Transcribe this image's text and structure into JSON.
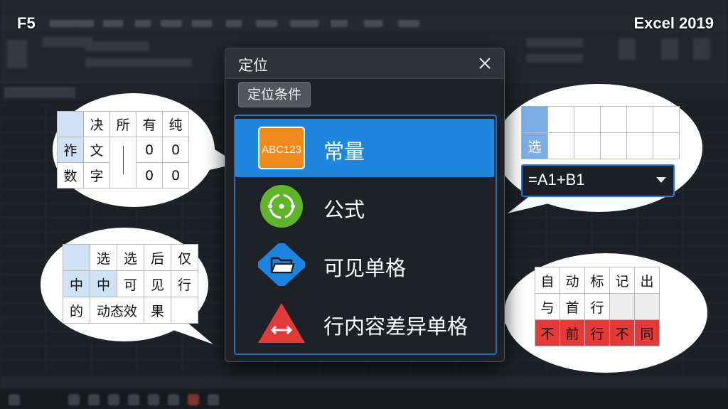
{
  "corner": {
    "shortcut": "F5",
    "version": "Excel 2019"
  },
  "dialog": {
    "title": "定位",
    "condition_button": "定位条件",
    "options": [
      {
        "label": "常量",
        "icon": "constants-icon",
        "icon_text": "ABC123",
        "selected": true
      },
      {
        "label": "公式",
        "icon": "formula-icon",
        "selected": false
      },
      {
        "label": "可见单格",
        "icon": "folder-icon",
        "selected": false
      },
      {
        "label": "行内容差异单格",
        "icon": "row-difference-icon",
        "selected": false
      }
    ]
  },
  "bubble_constants": {
    "rows": [
      [
        "",
        "决",
        "所",
        "有",
        "纯"
      ],
      [
        "祚",
        "文",
        "",
        "0",
        "0"
      ],
      [
        "数",
        "字",
        "",
        "0",
        "0"
      ]
    ]
  },
  "bubble_formula": {
    "select_label": "选",
    "dropdown_value": "=A1+B1"
  },
  "bubble_visible": {
    "rows": [
      [
        "",
        "选",
        "选",
        "后",
        "仅"
      ],
      [
        "中",
        "中",
        "可",
        "见",
        "行"
      ],
      [
        "的",
        "动态效",
        "",
        "果",
        ""
      ]
    ]
  },
  "bubble_rowdiff": {
    "rows": [
      [
        "自",
        "动",
        "标",
        "记",
        "出"
      ],
      [
        "与",
        "首",
        "行",
        "",
        ""
      ],
      [
        "不",
        "前",
        "行",
        "不",
        "同"
      ]
    ]
  },
  "colors": {
    "accent": "#1f86df",
    "constants_icon": "#f08a1c",
    "formula_icon": "#5fb42a",
    "folder_icon": "#1a84e0",
    "diff_icon": "#e23a3a",
    "highlight_red": "#e53a3a"
  }
}
